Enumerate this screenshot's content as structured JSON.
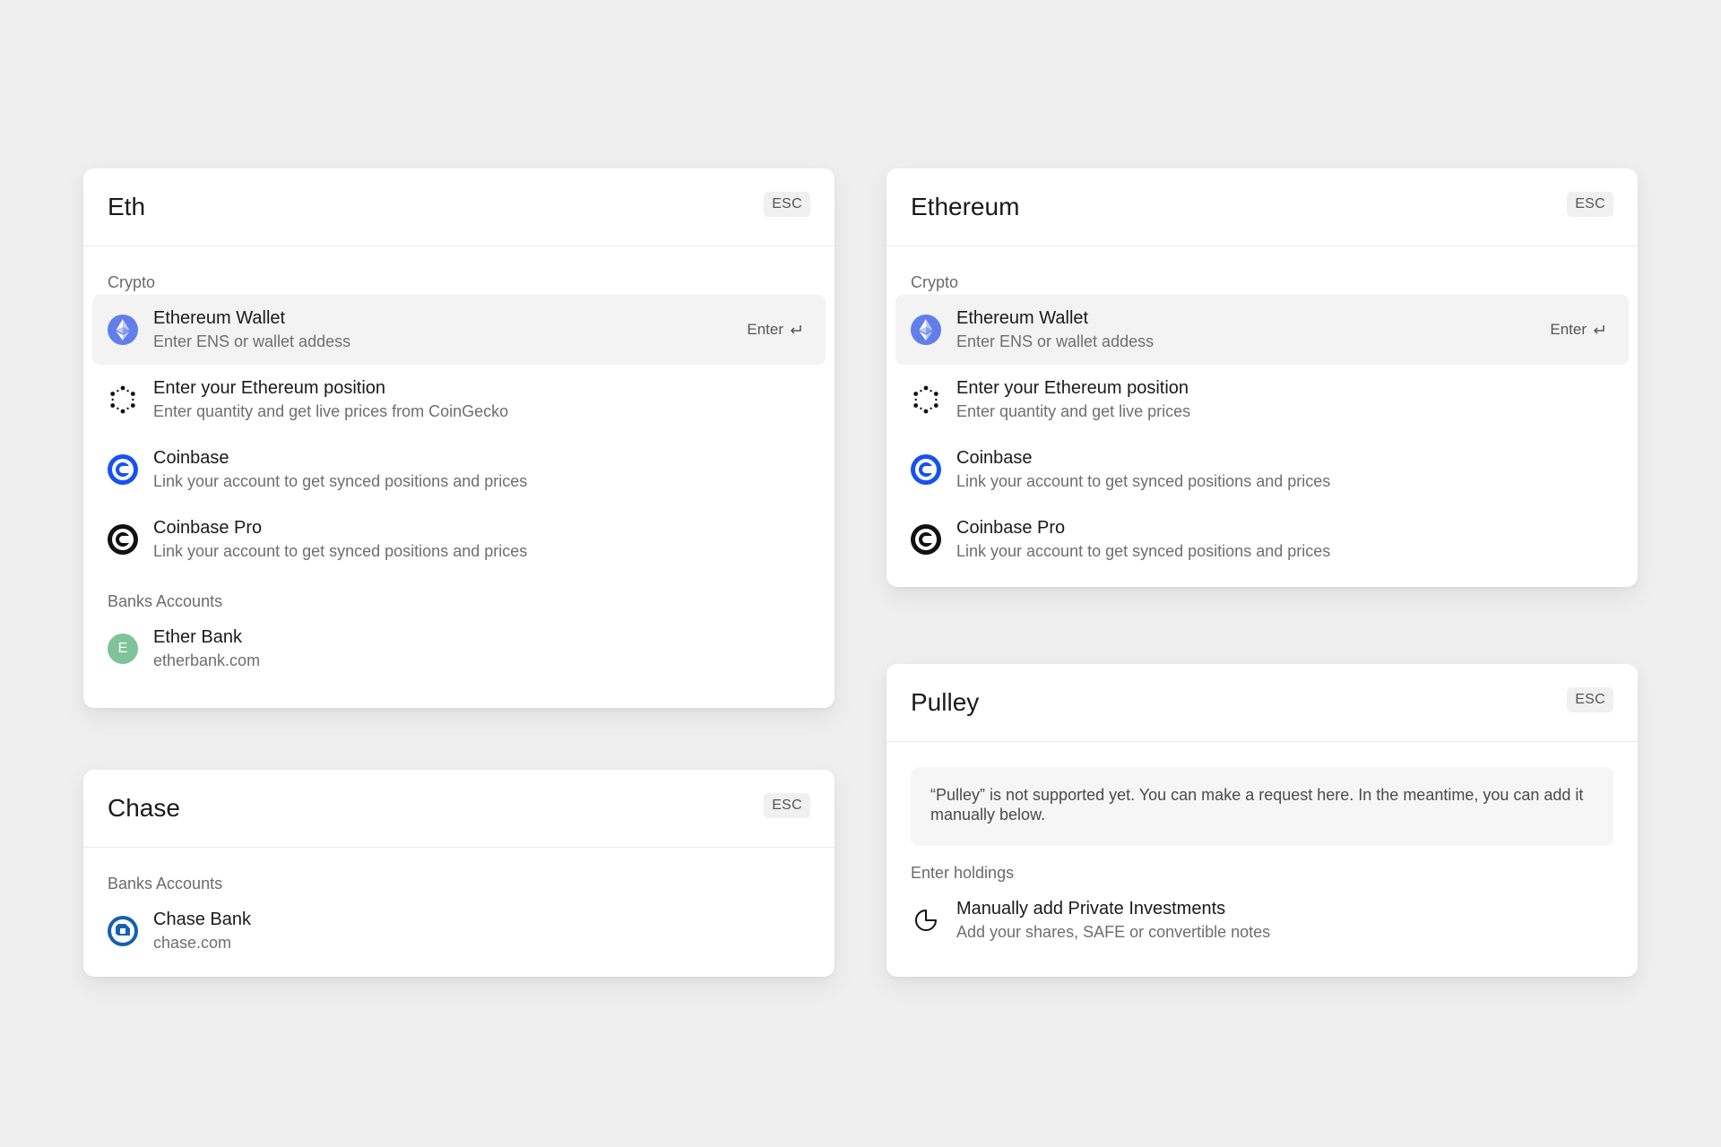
{
  "colors": {
    "background": "#efefef",
    "card": "#ffffff",
    "active_row": "#f3f3f3",
    "eth_purple": "#627eea",
    "coinbase_blue": "#1652f0",
    "chase_blue": "#155fb4",
    "ether_bank_green": "#7fc39a"
  },
  "card_eth": {
    "title": "Eth",
    "esc": "ESC",
    "sections": [
      {
        "label": "Crypto",
        "items": [
          {
            "icon": "ethereum-icon",
            "title": "Ethereum Wallet",
            "subtitle": "Enter ENS or wallet addess",
            "hint": "Enter",
            "active": true
          },
          {
            "icon": "dotted-hexagon-icon",
            "title": "Enter your Ethereum position",
            "subtitle": "Enter quantity and get live prices from CoinGecko"
          },
          {
            "icon": "coinbase-icon",
            "title": "Coinbase",
            "subtitle": "Link your account to get synced positions and prices"
          },
          {
            "icon": "coinbase-pro-icon",
            "title": "Coinbase Pro",
            "subtitle": "Link your account to get synced positions and prices"
          }
        ]
      },
      {
        "label": "Banks Accounts",
        "items": [
          {
            "icon": "letter-avatar-icon",
            "avatar_letter": "E",
            "title": "Ether Bank",
            "subtitle": "etherbank.com"
          }
        ]
      }
    ]
  },
  "card_chase": {
    "title": "Chase",
    "esc": "ESC",
    "sections": [
      {
        "label": "Banks Accounts",
        "items": [
          {
            "icon": "chase-icon",
            "title": "Chase Bank",
            "subtitle": "chase.com"
          }
        ]
      }
    ]
  },
  "card_ethereum": {
    "title": "Ethereum",
    "esc": "ESC",
    "sections": [
      {
        "label": "Crypto",
        "items": [
          {
            "icon": "ethereum-icon",
            "title": "Ethereum Wallet",
            "subtitle": "Enter ENS or wallet addess",
            "hint": "Enter",
            "active": true
          },
          {
            "icon": "dotted-hexagon-icon",
            "title": "Enter your Ethereum position",
            "subtitle": "Enter quantity and get live prices"
          },
          {
            "icon": "coinbase-icon",
            "title": "Coinbase",
            "subtitle": "Link your account to get synced positions and prices"
          },
          {
            "icon": "coinbase-pro-icon",
            "title": "Coinbase Pro",
            "subtitle": "Link your account to get synced positions and prices"
          }
        ]
      }
    ]
  },
  "card_pulley": {
    "title": "Pulley",
    "esc": "ESC",
    "notice": "“Pulley” is not supported yet. You can make a request here. In the meantime, you can add it manually below.",
    "section_label": "Enter holdings",
    "item": {
      "icon": "pie-chart-icon",
      "title": "Manually add Private Investments",
      "subtitle": "Add your shares, SAFE or convertible notes"
    }
  }
}
